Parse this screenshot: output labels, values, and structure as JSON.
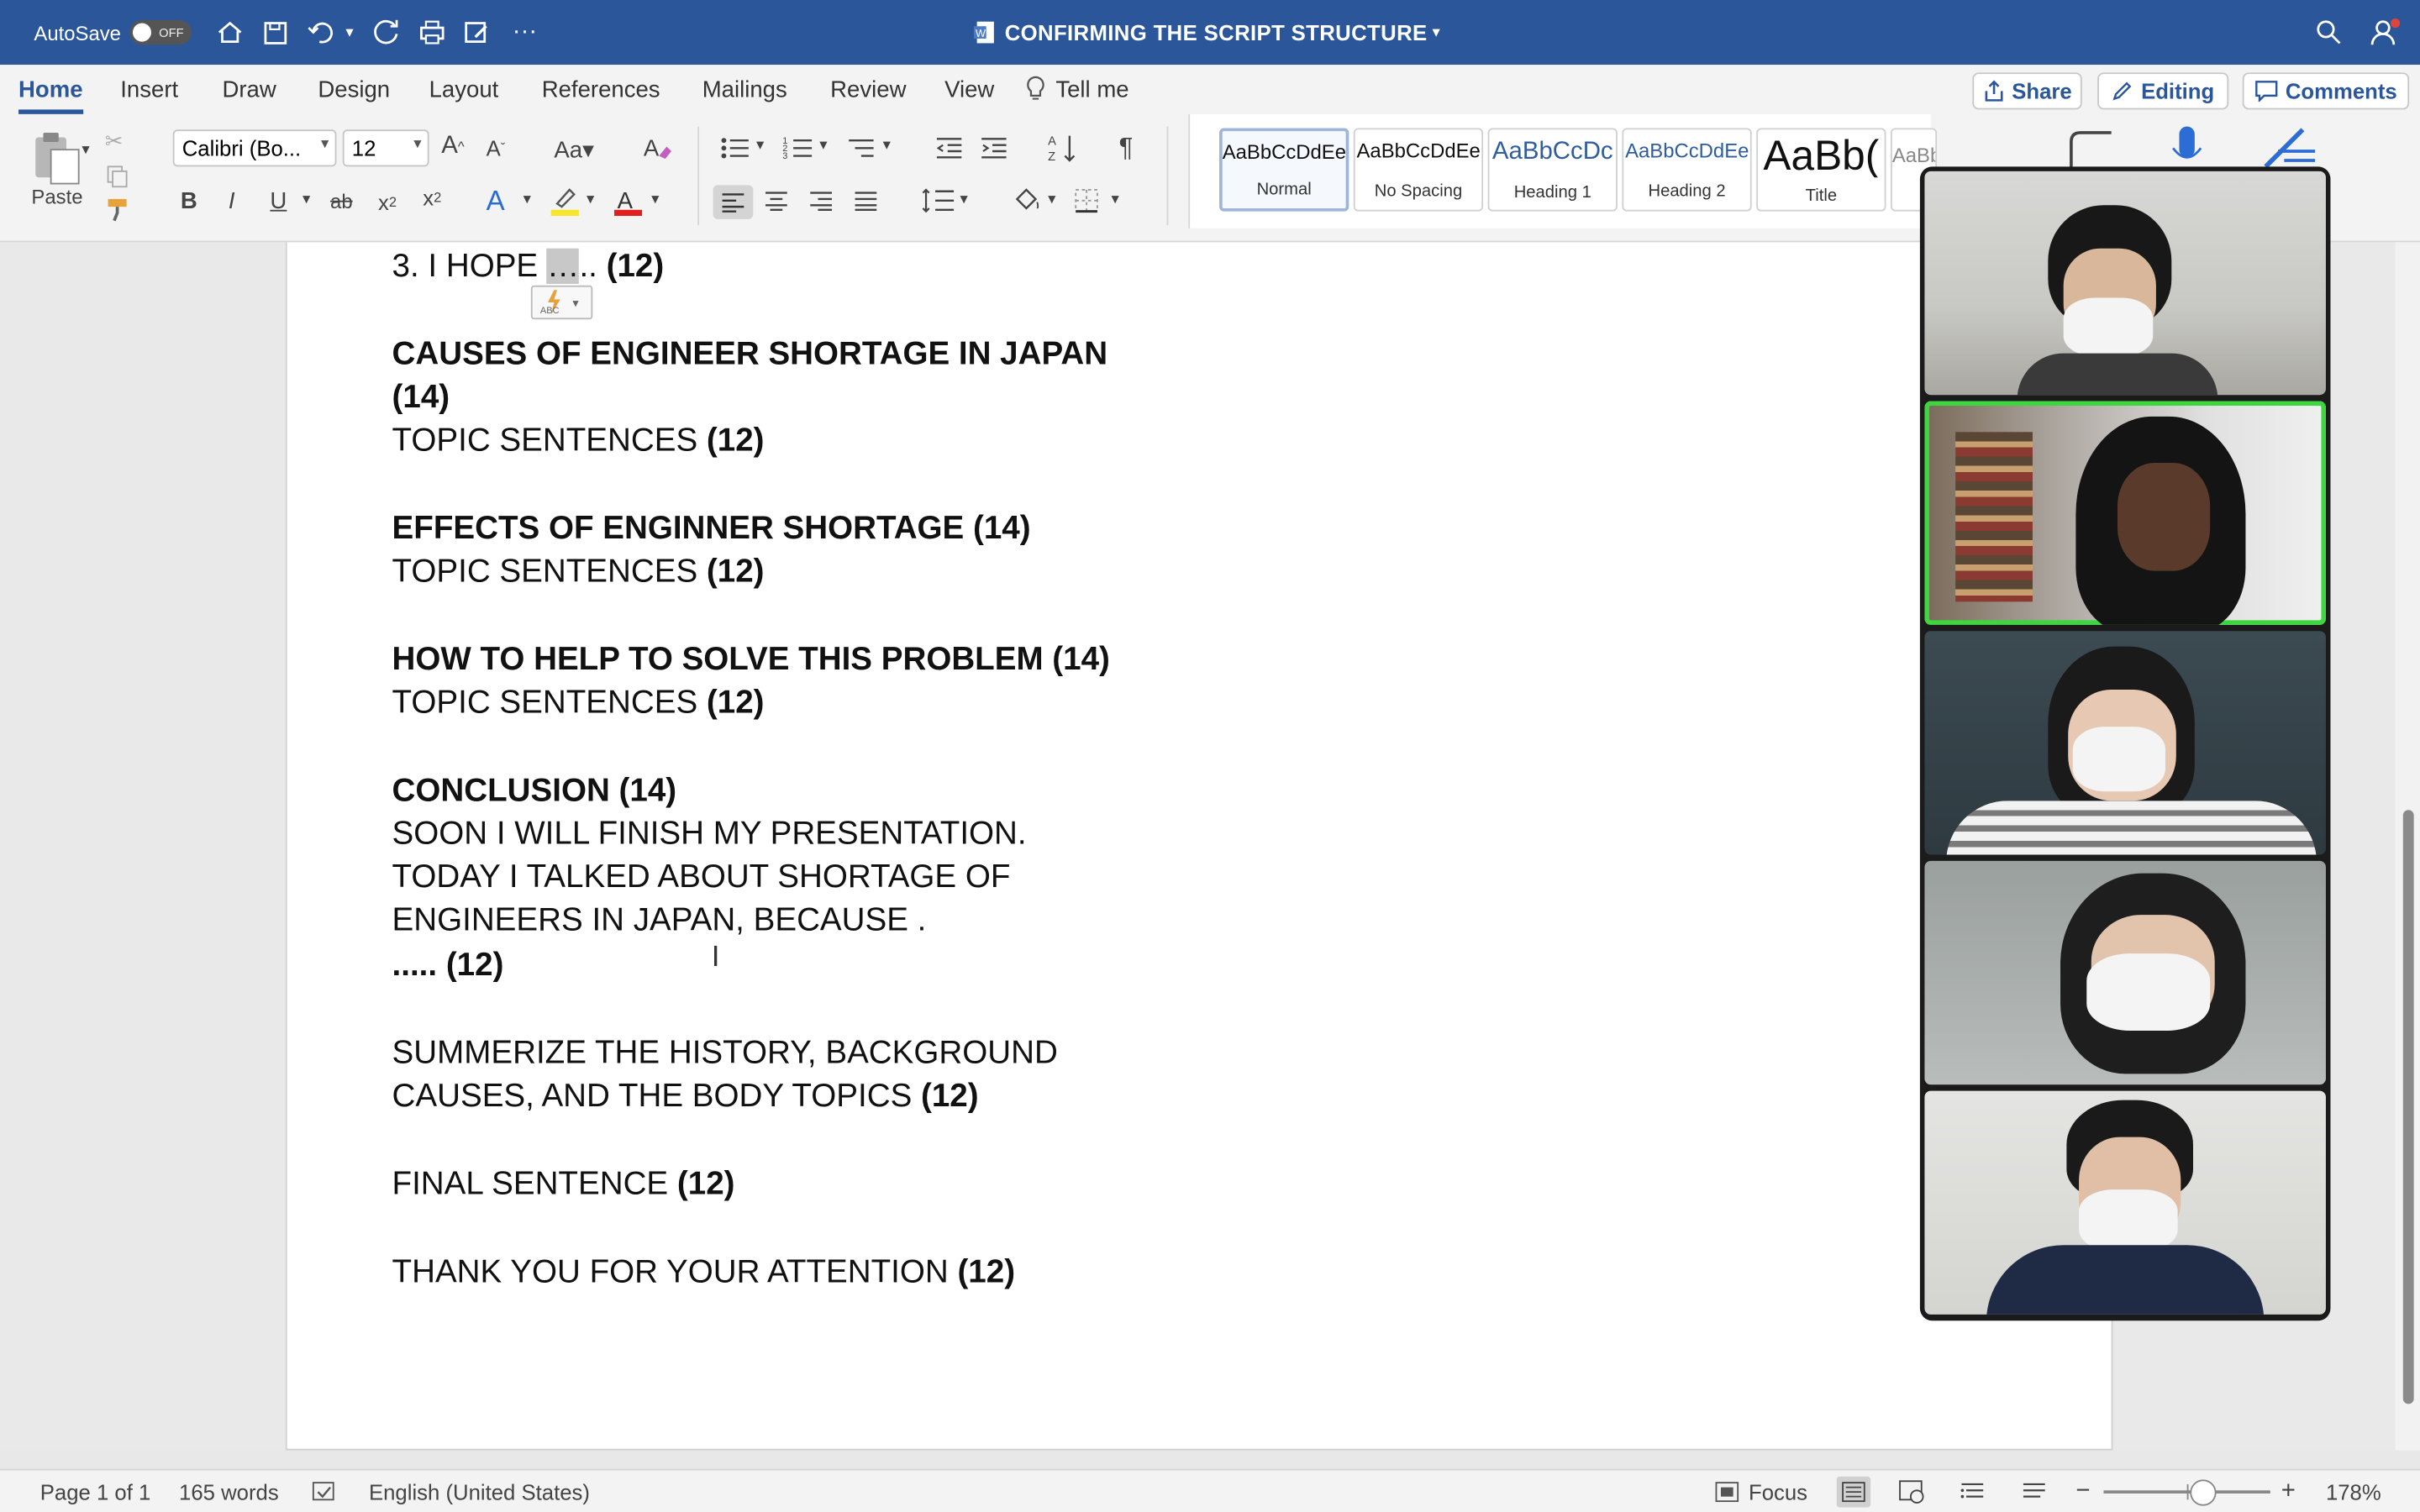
{
  "titlebar": {
    "autosave_label": "AutoSave",
    "autosave_state": "OFF",
    "doc_title": "CONFIRMING THE SCRIPT STRUCTURE"
  },
  "tabs": [
    "Home",
    "Insert",
    "Draw",
    "Design",
    "Layout",
    "References",
    "Mailings",
    "Review",
    "View"
  ],
  "tell_me": "Tell me",
  "share_label": "Share",
  "editing_label": "Editing",
  "comments_label": "Comments",
  "ribbon": {
    "paste_label": "Paste",
    "font_name": "Calibri (Bo...",
    "font_size": "12",
    "styles": [
      {
        "preview": "AaBbCcDdEe",
        "name": "Normal"
      },
      {
        "preview": "AaBbCcDdEe",
        "name": "No Spacing"
      },
      {
        "preview": "AaBbCcDc",
        "name": "Heading 1"
      },
      {
        "preview": "AaBbCcDdEe",
        "name": "Heading 2"
      },
      {
        "preview": "AaBb(",
        "name": "Title"
      },
      {
        "preview": "AaBbCcDdEe",
        "name": ""
      }
    ]
  },
  "document": {
    "line1_a": "3. I HOPE ",
    "line1_b": "…",
    "line1_c": ".. ",
    "line1_d": "(12)",
    "causes_heading_1": "CAUSES OF ENGINEER SHORTAGE IN JAPAN",
    "causes_heading_2": "(14)",
    "topic_text": "TOPIC SENTENCES ",
    "topic_size": "(12)",
    "effects_heading": "EFFECTS OF ENGINNER SHORTAGE (14)",
    "solve_heading": "HOW TO HELP TO SOLVE THIS PROBLEM (14)",
    "conclusion_heading": "CONCLUSION (14)",
    "conclusion_1": "SOON I WILL FINISH MY PRESENTATION.",
    "conclusion_2": "TODAY I TALKED ABOUT SHORTAGE OF",
    "conclusion_3": "ENGINEERS IN JAPAN, BECAUSE .",
    "conclusion_4": "..... (12)",
    "summerize_1": "SUMMERIZE THE HISTORY, BACKGROUND",
    "summerize_2": "CAUSES, AND THE BODY TOPICS ",
    "summerize_2b": "(12)",
    "final_text": "FINAL SENTENCE ",
    "final_size": "(12)",
    "thanks_text": "THANK YOU FOR YOUR ATTENTION ",
    "thanks_size": "(12)"
  },
  "status": {
    "page": "Page 1 of 1",
    "words": "165 words",
    "language": "English (United States)",
    "focus": "Focus",
    "zoom": "178%"
  },
  "colors": {
    "titlebar": "#2b579a",
    "accent": "#2b579a",
    "active_speaker": "#3ed63e"
  }
}
